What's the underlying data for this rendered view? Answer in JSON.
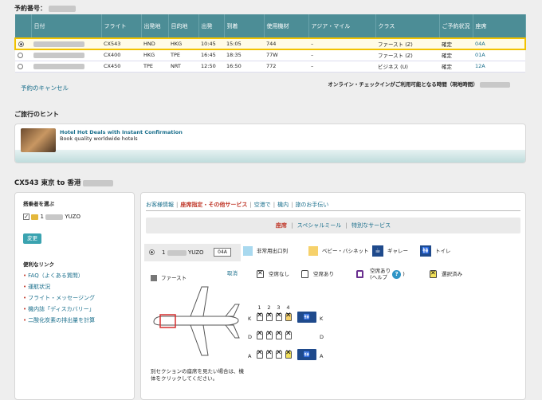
{
  "booking": {
    "title": "予約番号："
  },
  "table": {
    "headers": [
      "日付",
      "フライト",
      "出発地",
      "目的地",
      "出発",
      "到着",
      "使用機材",
      "アジア・マイル",
      "クラス",
      "ご予約状況",
      "座席"
    ],
    "rows": [
      {
        "selected": true,
        "flight": "CX543",
        "from": "HND",
        "to": "HKG",
        "dep": "10:45",
        "arr": "15:05",
        "aircraft": "744",
        "miles": "–",
        "cls": "ファースト (Z)",
        "status": "確定",
        "seat": "04A"
      },
      {
        "selected": false,
        "flight": "CX400",
        "from": "HKG",
        "to": "TPE",
        "dep": "16:45",
        "arr": "18:35",
        "aircraft": "77W",
        "miles": "–",
        "cls": "ファースト (Z)",
        "status": "確定",
        "seat": "01A"
      },
      {
        "selected": false,
        "flight": "CX450",
        "from": "TPE",
        "to": "NRT",
        "dep": "12:50",
        "arr": "16:50",
        "aircraft": "772",
        "miles": "–",
        "cls": "ビジネス (U)",
        "status": "確定",
        "seat": "12A"
      }
    ]
  },
  "cancel_link": "予約のキャンセル",
  "checkin_note": "オンライン・チェックインがご利用可能となる時間（現地時間）",
  "tips": {
    "title": "ご旅行のヒント",
    "headline": "Hotel Hot Deals with Instant Confirmation",
    "sub": "Book quality worldwide hotels"
  },
  "leg_title": "CX543 東京 to 香港 ",
  "left": {
    "choose_pax": "搭乗者を選ぶ",
    "pax_name": "YUZO",
    "pax_num": "1",
    "change_button": "変更",
    "links_title": "便利なリンク",
    "links": [
      "FAQ（よくある質問）",
      "運航状況",
      "フライト・メッセージング",
      "機内誌「ディスカバリー」",
      "二酸化炭素の排出量を計算"
    ]
  },
  "tabs": [
    {
      "label": "お客様情報",
      "active": false
    },
    {
      "label": "座席指定・その他サービス",
      "active": true
    },
    {
      "label": "空港で",
      "active": false
    },
    {
      "label": "機内",
      "active": false
    },
    {
      "label": "旅のお手伝い",
      "active": false
    }
  ],
  "subtabs": [
    {
      "label": "座席",
      "active": true
    },
    {
      "label": "スペシャルミール",
      "active": false
    },
    {
      "label": "特別なサービス",
      "active": false
    }
  ],
  "passenger": {
    "num": "1",
    "name": "YUZO",
    "seat": "04A"
  },
  "legend": {
    "exit_row": "非常用出口列",
    "bassinet": "ベビー・バシネット",
    "galley": "ギャレー",
    "toilet": "トイレ",
    "first": "ファースト",
    "cancel": "取消",
    "unavailable": "空席なし",
    "available": "空席あり",
    "assist": "空席あり",
    "assist_sub": "(ヘルプ",
    "selected": "選択済み",
    "help_q": "?"
  },
  "seatmap": {
    "cols": [
      "1",
      "2",
      "3",
      "4"
    ],
    "rows": [
      "K",
      "D",
      "A"
    ],
    "hint": "別セクションの座席を見たい場合は、機体をクリックしてください。"
  },
  "colors": {
    "header_teal": "#4c8d96",
    "accent_red": "#c0392b",
    "link": "#1a6f8c",
    "selected_yellow": "#f3e25b",
    "exit_blue": "#a9d9ef",
    "bassinet_yellow": "#f6d16b",
    "facility_navy": "#1f4a8c"
  }
}
